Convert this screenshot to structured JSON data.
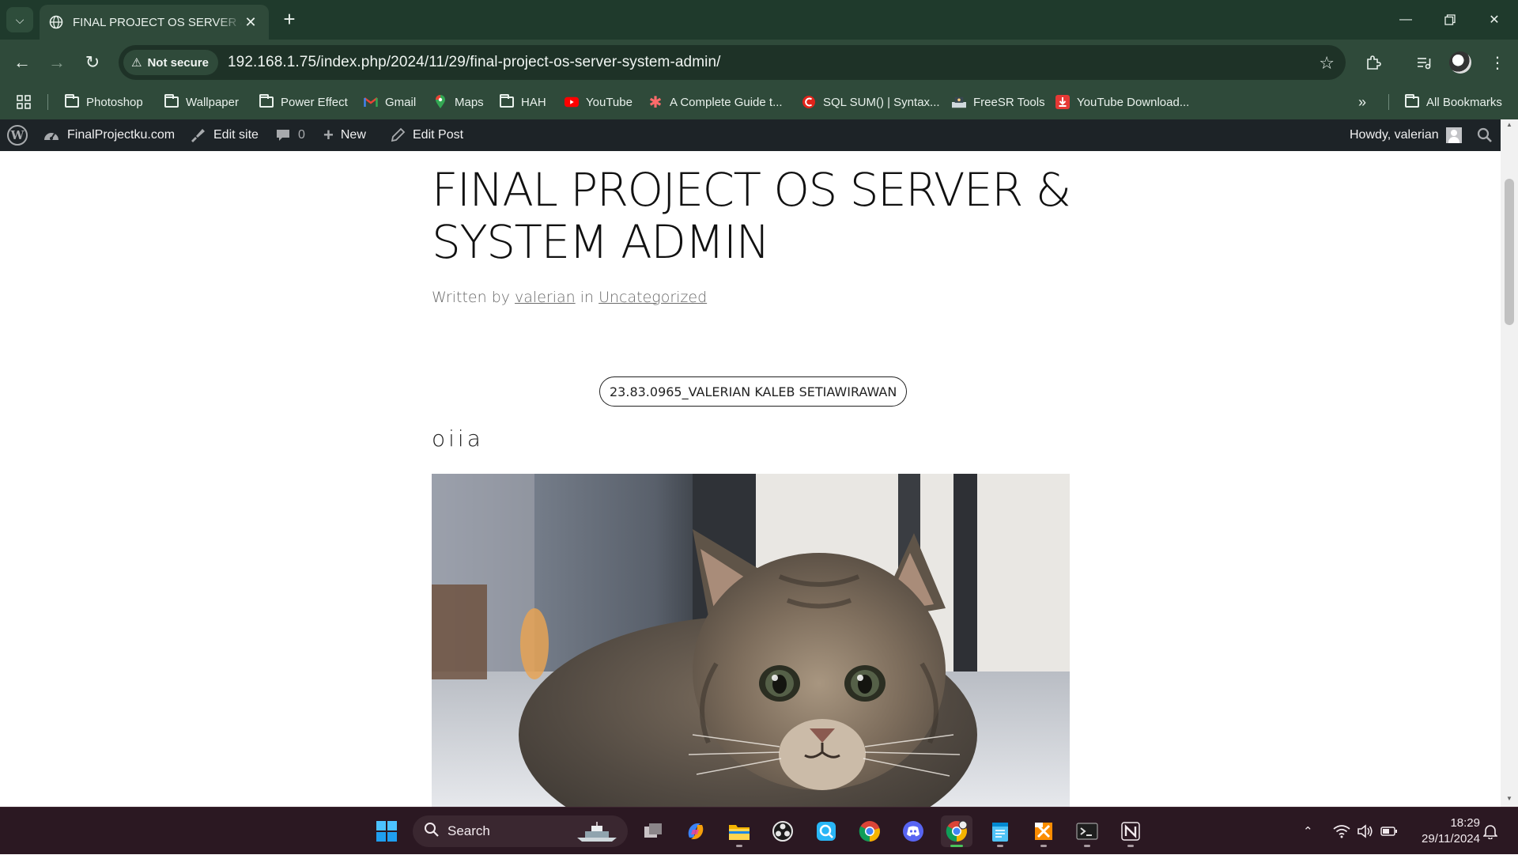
{
  "browser": {
    "tab_title": "FINAL PROJECT OS SERVER & SYSTEM ADMIN",
    "security_label": "Not secure",
    "url": "192.168.1.75/index.php/2024/11/29/final-project-os-server-system-admin/"
  },
  "bookmarks": [
    {
      "label": "Photoshop",
      "icon": "folder-icon"
    },
    {
      "label": "Wallpaper",
      "icon": "folder-icon"
    },
    {
      "label": "Power Effect",
      "icon": "folder-icon"
    },
    {
      "label": "Gmail",
      "icon": "gmail-icon"
    },
    {
      "label": "Maps",
      "icon": "maps-icon"
    },
    {
      "label": "HAH",
      "icon": "folder-icon"
    },
    {
      "label": "YouTube",
      "icon": "youtube-icon"
    },
    {
      "label": "A Complete Guide t...",
      "icon": "asterisk-icon"
    },
    {
      "label": "SQL SUM() | Syntax...",
      "icon": "sql-icon"
    },
    {
      "label": "FreeSR Tools",
      "icon": "freesr-icon"
    },
    {
      "label": "YouTube Download...",
      "icon": "download-icon"
    }
  ],
  "all_bookmarks_label": "All Bookmarks",
  "adminbar": {
    "site_name": "FinalProjectku.com",
    "edit_site": "Edit site",
    "comments_count": "0",
    "new_label": "New",
    "edit_post": "Edit Post",
    "howdy": "Howdy, valerian"
  },
  "post": {
    "title": "FINAL PROJECT OS SERVER & SYSTEM ADMIN",
    "byline_prefix": "Written by",
    "author": "valerian",
    "byline_in": "in",
    "category": "Uncategorized",
    "tag_pill": "23.83.0965_VALERIAN KALEB SETIAWIRAWAN",
    "body": "oiia"
  },
  "taskbar": {
    "search_placeholder": "Search",
    "time": "18:29",
    "date": "29/11/2024"
  },
  "colors": {
    "chrome_dark": "#1f3a2c",
    "chrome_toolbar": "#2f4a3a",
    "wp_adminbar": "#1d2327",
    "taskbar": "#2b1822"
  }
}
